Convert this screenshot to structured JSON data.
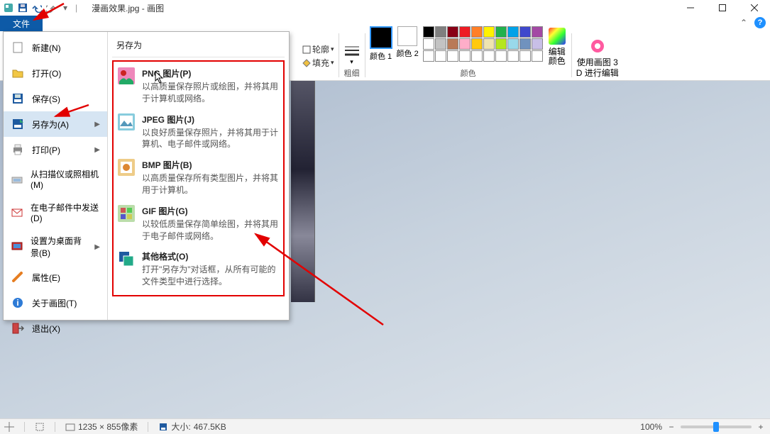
{
  "title": "漫画效果.jpg - 画图",
  "file_tab": "文件",
  "ribbon": {
    "outline": "轮廓",
    "fill": "填充",
    "thickness": "粗细",
    "color1": "颜色 1",
    "color2": "颜色 2",
    "colors_group": "颜色",
    "edit_colors_l1": "编辑",
    "edit_colors_l2": "颜色",
    "use3d_l1": "使用画图 3",
    "use3d_l2": "D 进行编辑"
  },
  "file_menu": {
    "new": "新建(N)",
    "open": "打开(O)",
    "save": "保存(S)",
    "save_as": "另存为(A)",
    "print": "打印(P)",
    "scanner": "从扫描仪或照相机(M)",
    "email": "在电子邮件中发送(D)",
    "wallpaper": "设置为桌面背景(B)",
    "properties": "属性(E)",
    "about": "关于画图(T)",
    "exit": "退出(X)"
  },
  "save_as_panel": {
    "header": "另存为",
    "png_title": "PNG 图片(P)",
    "png_desc": "以高质量保存照片或绘图，并将其用于计算机或网络。",
    "jpeg_title": "JPEG 图片(J)",
    "jpeg_desc": "以良好质量保存照片，并将其用于计算机、电子邮件或网络。",
    "bmp_title": "BMP 图片(B)",
    "bmp_desc": "以高质量保存所有类型图片，并将其用于计算机。",
    "gif_title": "GIF 图片(G)",
    "gif_desc": "以较低质量保存简单绘图，并将其用于电子邮件或网络。",
    "other_title": "其他格式(O)",
    "other_desc": "打开\"另存为\"对话框，从所有可能的文件类型中进行选择。"
  },
  "statusbar": {
    "dimensions": "1235 × 855像素",
    "size_label": "大小:",
    "size_value": "467.5KB",
    "zoom": "100%"
  },
  "palette": [
    "#000000",
    "#7f7f7f",
    "#880015",
    "#ed1c24",
    "#ff7f27",
    "#fff200",
    "#22b14c",
    "#00a2e8",
    "#3f48cc",
    "#a349a4",
    "#ffffff",
    "#c3c3c3",
    "#b97a57",
    "#ffaec9",
    "#ffc90e",
    "#efe4b0",
    "#b5e61d",
    "#99d9ea",
    "#7092be",
    "#c8bfe7",
    "#ffffff",
    "#ffffff",
    "#ffffff",
    "#ffffff",
    "#ffffff",
    "#ffffff",
    "#ffffff",
    "#ffffff",
    "#ffffff",
    "#ffffff"
  ]
}
